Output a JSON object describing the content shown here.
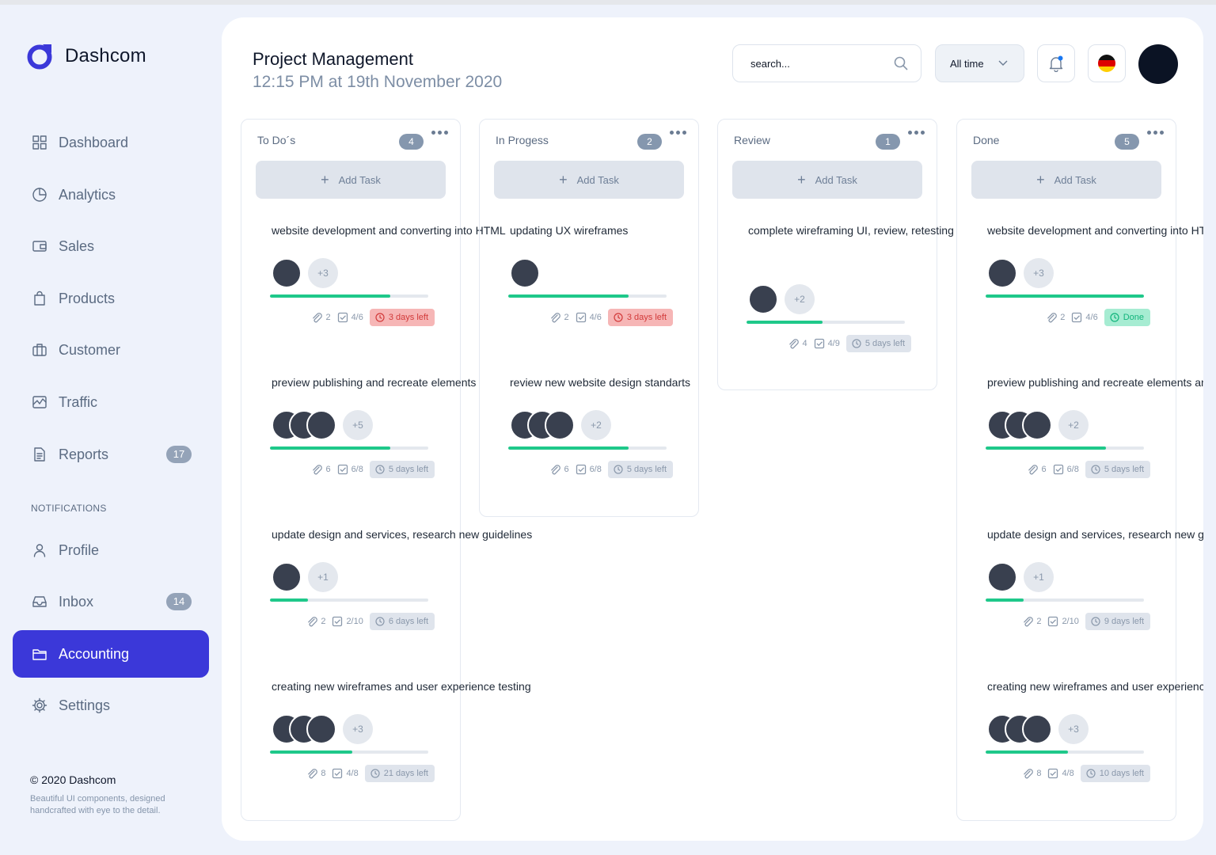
{
  "brand": {
    "name": "Dashcom"
  },
  "sidebar": {
    "items": [
      {
        "label": "Dashboard",
        "icon": "grid-icon"
      },
      {
        "label": "Analytics",
        "icon": "pie-chart-icon"
      },
      {
        "label": "Sales",
        "icon": "wallet-icon"
      },
      {
        "label": "Products",
        "icon": "shopping-bag-icon"
      },
      {
        "label": "Customer",
        "icon": "briefcase-icon"
      },
      {
        "label": "Traffic",
        "icon": "activity-chart-icon"
      },
      {
        "label": "Reports",
        "icon": "document-icon",
        "count": "17"
      },
      {
        "label": "Profile",
        "icon": "user-icon"
      },
      {
        "label": "Inbox",
        "icon": "inbox-icon",
        "count": "14"
      },
      {
        "label": "Accounting",
        "icon": "folder-icon",
        "active": true
      },
      {
        "label": "Settings",
        "icon": "gear-icon"
      }
    ],
    "section_label": "NOTIFICATIONS",
    "footer_copyright": "© 2020 Dashcom",
    "footer_text": "Beautiful UI components, designed handcrafted with eye to the detail."
  },
  "header": {
    "title": "Project Management",
    "subtitle": "12:15 PM at 19th November 2020",
    "search_placeholder": "search...",
    "time_filter": "All time",
    "flag": "germany-flag-icon"
  },
  "colors": {
    "accent": "#3b38d9",
    "progress": "#1fc88a",
    "danger": "#d23a3a",
    "success": "#12b47b"
  },
  "board": {
    "add_task_label": "Add Task",
    "columns": [
      {
        "title": "To Do´s",
        "count": "4",
        "cards": [
          {
            "title": "website development and converting into HTML",
            "avatars": 1,
            "more": "+3",
            "progress": 0.76,
            "attachments": "2",
            "checklist": "4/6",
            "due": "3 days left",
            "status": "red"
          },
          {
            "title": "preview publishing and recreate elements",
            "avatars": 3,
            "more": "+5",
            "progress": 0.76,
            "attachments": "6",
            "checklist": "6/8",
            "due": "5 days left",
            "status": "grey"
          },
          {
            "title": "update design and services, research new guidelines",
            "avatars": 1,
            "more": "+1",
            "progress": 0.24,
            "attachments": "2",
            "checklist": "2/10",
            "due": "6 days left",
            "status": "grey"
          },
          {
            "title": "creating new wireframes and user experience testing",
            "avatars": 3,
            "more": "+3",
            "progress": 0.52,
            "attachments": "8",
            "checklist": "4/8",
            "due": "21 days left",
            "status": "grey"
          }
        ]
      },
      {
        "title": "In Progess",
        "count": "2",
        "cards": [
          {
            "title": "updating UX wireframes",
            "avatars": 1,
            "more": "",
            "progress": 0.76,
            "attachments": "2",
            "checklist": "4/6",
            "due": "3 days left",
            "status": "red"
          },
          {
            "title": "review new website design standarts",
            "avatars": 3,
            "more": "+2",
            "progress": 0.76,
            "attachments": "6",
            "checklist": "6/8",
            "due": "5 days left",
            "status": "grey"
          }
        ]
      },
      {
        "title": "Review",
        "count": "1",
        "cards": [
          {
            "title": "complete wireframing UI, review, retesting",
            "avatars": 1,
            "more": "+2",
            "progress": 0.48,
            "attachments": "4",
            "checklist": "4/9",
            "due": "5 days left",
            "status": "grey"
          }
        ]
      },
      {
        "title": "Done",
        "count": "5",
        "cards": [
          {
            "title": "website development and converting into HTML",
            "avatars": 1,
            "more": "+3",
            "progress": 1.0,
            "attachments": "2",
            "checklist": "4/6",
            "due": "Done",
            "status": "green"
          },
          {
            "title": "preview publishing and recreate elements and",
            "avatars": 3,
            "more": "+2",
            "progress": 0.76,
            "attachments": "6",
            "checklist": "6/8",
            "due": "5 days left",
            "status": "grey"
          },
          {
            "title": "update design and services, research new guidelines",
            "avatars": 1,
            "more": "+1",
            "progress": 0.24,
            "attachments": "2",
            "checklist": "2/10",
            "due": "9 days left",
            "status": "grey"
          },
          {
            "title": "creating new wireframes and user experience testing",
            "avatars": 3,
            "more": "+3",
            "progress": 0.52,
            "attachments": "8",
            "checklist": "4/8",
            "due": "10 days left",
            "status": "grey"
          }
        ]
      }
    ]
  }
}
